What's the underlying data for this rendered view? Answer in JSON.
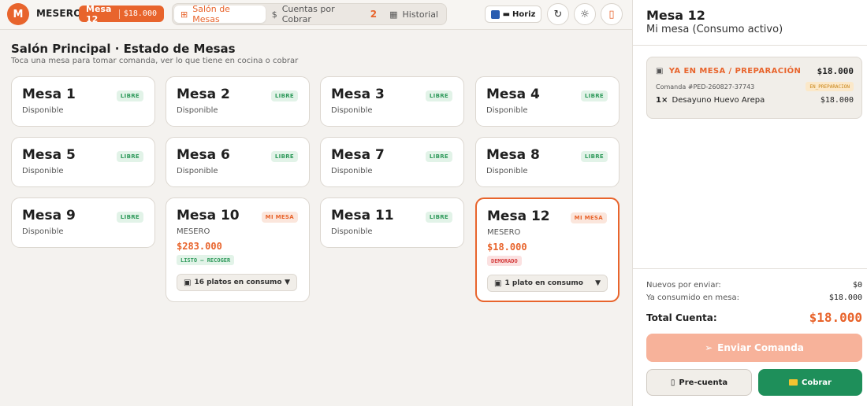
{
  "header": {
    "avatar_initial": "M",
    "brand": "MESERO",
    "current_table": {
      "label": "Mesa 12",
      "amount": "$18.000"
    },
    "tabs": [
      {
        "label": "Salón de Mesas",
        "icon": "grid-icon",
        "active": true
      },
      {
        "label": "Cuentas por Cobrar",
        "icon": "dollar-icon",
        "badge": "2"
      },
      {
        "label": "Historial",
        "icon": "calendar-icon"
      }
    ],
    "layout_toggle": "Horiz"
  },
  "main": {
    "title": "Salón Principal · Estado de Mesas",
    "subtitle": "Toca una mesa para tomar comanda, ver lo que tiene en cocina o cobrar",
    "tables": [
      {
        "name": "Mesa 1",
        "status": "Disponible",
        "tag": "LIBRE"
      },
      {
        "name": "Mesa 2",
        "status": "Disponible",
        "tag": "LIBRE"
      },
      {
        "name": "Mesa 3",
        "status": "Disponible",
        "tag": "LIBRE"
      },
      {
        "name": "Mesa 4",
        "status": "Disponible",
        "tag": "LIBRE"
      },
      {
        "name": "Mesa 5",
        "status": "Disponible",
        "tag": "LIBRE"
      },
      {
        "name": "Mesa 6",
        "status": "Disponible",
        "tag": "LIBRE"
      },
      {
        "name": "Mesa 7",
        "status": "Disponible",
        "tag": "LIBRE"
      },
      {
        "name": "Mesa 8",
        "status": "Disponible",
        "tag": "LIBRE"
      },
      {
        "name": "Mesa 9",
        "status": "Disponible",
        "tag": "LIBRE"
      },
      {
        "name": "Mesa 10",
        "status": "MESERO",
        "tag": "MI MESA",
        "amount": "$283.000",
        "state": "LISTO — RECOGER",
        "dishes": "16 platos en consumo"
      },
      {
        "name": "Mesa 11",
        "status": "Disponible",
        "tag": "LIBRE"
      },
      {
        "name": "Mesa 12",
        "status": "MESERO",
        "tag": "MI MESA",
        "amount": "$18.000",
        "state": "DEMORADO",
        "dishes": "1 plato en consumo"
      }
    ]
  },
  "side": {
    "title": "Mesa 12",
    "subtitle": "Mi mesa (Consumo activo)",
    "order": {
      "header": "YA EN MESA / PREPARACIÓN",
      "total": "$18.000",
      "id": "Comanda #PED-260827-37743",
      "state": "EN_PREPARACION",
      "item_qty": "1×",
      "item_name": "Desayuno Huevo Arepa",
      "item_amount": "$18.000"
    },
    "summary": {
      "new_label": "Nuevos por enviar:",
      "new_value": "$0",
      "consumed_label": "Ya consumido en mesa:",
      "consumed_value": "$18.000",
      "total_label": "Total Cuenta:",
      "total_value": "$18.000"
    },
    "buttons": {
      "send": "Enviar Comanda",
      "precuenta": "Pre-cuenta",
      "pay": "Cobrar"
    }
  },
  "colors": {
    "accent": "#e8642c",
    "success": "#1e8f5a",
    "free_tag": "#2f9a5b",
    "delayed": "#d43c3c"
  }
}
